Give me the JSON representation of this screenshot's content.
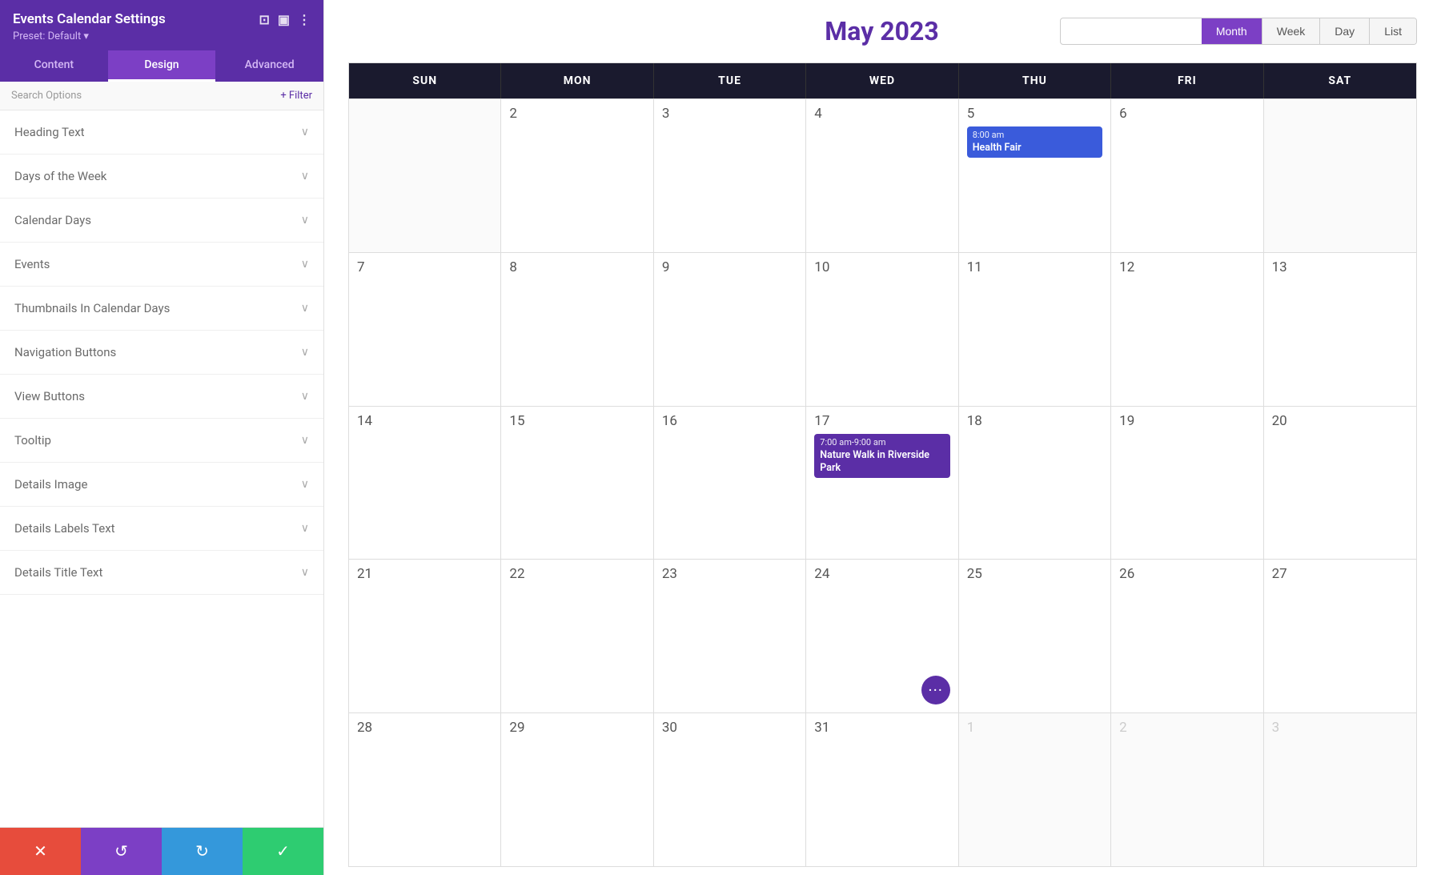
{
  "panel": {
    "title": "Events Calendar Settings",
    "preset": "Preset: Default ▾",
    "tabs": [
      {
        "id": "content",
        "label": "Content",
        "active": false
      },
      {
        "id": "design",
        "label": "Design",
        "active": true
      },
      {
        "id": "advanced",
        "label": "Advanced",
        "active": false
      }
    ],
    "search_placeholder": "Search Options",
    "filter_label": "+ Filter",
    "settings_items": [
      {
        "id": "heading-text",
        "label": "Heading Text"
      },
      {
        "id": "days-of-week",
        "label": "Days of the Week"
      },
      {
        "id": "calendar-days",
        "label": "Calendar Days"
      },
      {
        "id": "events",
        "label": "Events"
      },
      {
        "id": "thumbnails",
        "label": "Thumbnails In Calendar Days"
      },
      {
        "id": "nav-buttons",
        "label": "Navigation Buttons"
      },
      {
        "id": "view-buttons",
        "label": "View Buttons"
      },
      {
        "id": "tooltip",
        "label": "Tooltip"
      },
      {
        "id": "details-image",
        "label": "Details Image"
      },
      {
        "id": "details-labels-text",
        "label": "Details Labels Text"
      },
      {
        "id": "details-title-text",
        "label": "Details Title Text"
      }
    ],
    "bottom_buttons": [
      {
        "id": "cancel",
        "icon": "✕",
        "class": "btn-cancel"
      },
      {
        "id": "undo",
        "icon": "↺",
        "class": "btn-undo"
      },
      {
        "id": "redo",
        "icon": "↻",
        "class": "btn-redo"
      },
      {
        "id": "save",
        "icon": "✓",
        "class": "btn-save"
      }
    ]
  },
  "calendar": {
    "title": "May 2023",
    "title_color": "#5b2ea6",
    "view_buttons": [
      {
        "label": "Month",
        "active": true
      },
      {
        "label": "Week",
        "active": false
      },
      {
        "label": "Day",
        "active": false
      },
      {
        "label": "List",
        "active": false
      }
    ],
    "day_headers": [
      "MON",
      "TUE",
      "WED",
      "THU",
      "FRI",
      "SAT",
      "SAT"
    ],
    "rows": [
      {
        "cells": [
          {
            "day": "",
            "grayed": true
          },
          {
            "day": "2",
            "grayed": false
          },
          {
            "day": "3",
            "grayed": false
          },
          {
            "day": "4",
            "grayed": false
          },
          {
            "day": "5",
            "grayed": false,
            "event": {
              "time": "8:00 am",
              "name": "Health Fair",
              "color": "event-blue"
            }
          },
          {
            "day": "6",
            "grayed": false
          }
        ]
      },
      {
        "cells": [
          {
            "day": "8",
            "grayed": false
          },
          {
            "day": "9",
            "grayed": false
          },
          {
            "day": "10",
            "grayed": false
          },
          {
            "day": "11",
            "grayed": false
          },
          {
            "day": "12",
            "grayed": false
          },
          {
            "day": "13",
            "grayed": false
          }
        ]
      },
      {
        "cells": [
          {
            "day": "15",
            "grayed": false
          },
          {
            "day": "16",
            "grayed": false
          },
          {
            "day": "17",
            "grayed": false,
            "event": {
              "time": "7:00 am-9:00 am",
              "name": "Nature Walk in Riverside Park",
              "color": "event-purple"
            }
          },
          {
            "day": "18",
            "grayed": false
          },
          {
            "day": "19",
            "grayed": false
          },
          {
            "day": "20",
            "grayed": false
          }
        ]
      },
      {
        "cells": [
          {
            "day": "22",
            "grayed": false
          },
          {
            "day": "23",
            "grayed": false
          },
          {
            "day": "24",
            "grayed": false,
            "more": true
          },
          {
            "day": "25",
            "grayed": false
          },
          {
            "day": "26",
            "grayed": false
          },
          {
            "day": "27",
            "grayed": false
          }
        ]
      },
      {
        "cells": [
          {
            "day": "29",
            "grayed": false
          },
          {
            "day": "30",
            "grayed": false
          },
          {
            "day": "31",
            "grayed": false
          },
          {
            "day": "1",
            "grayed": true
          },
          {
            "day": "2",
            "grayed": true
          },
          {
            "day": "3",
            "grayed": true
          }
        ]
      }
    ]
  },
  "icons": {
    "minimize": "⊡",
    "expand": "▣",
    "more": "⋮",
    "chevron_down": "∨",
    "plus": "+",
    "dots": "•••"
  }
}
